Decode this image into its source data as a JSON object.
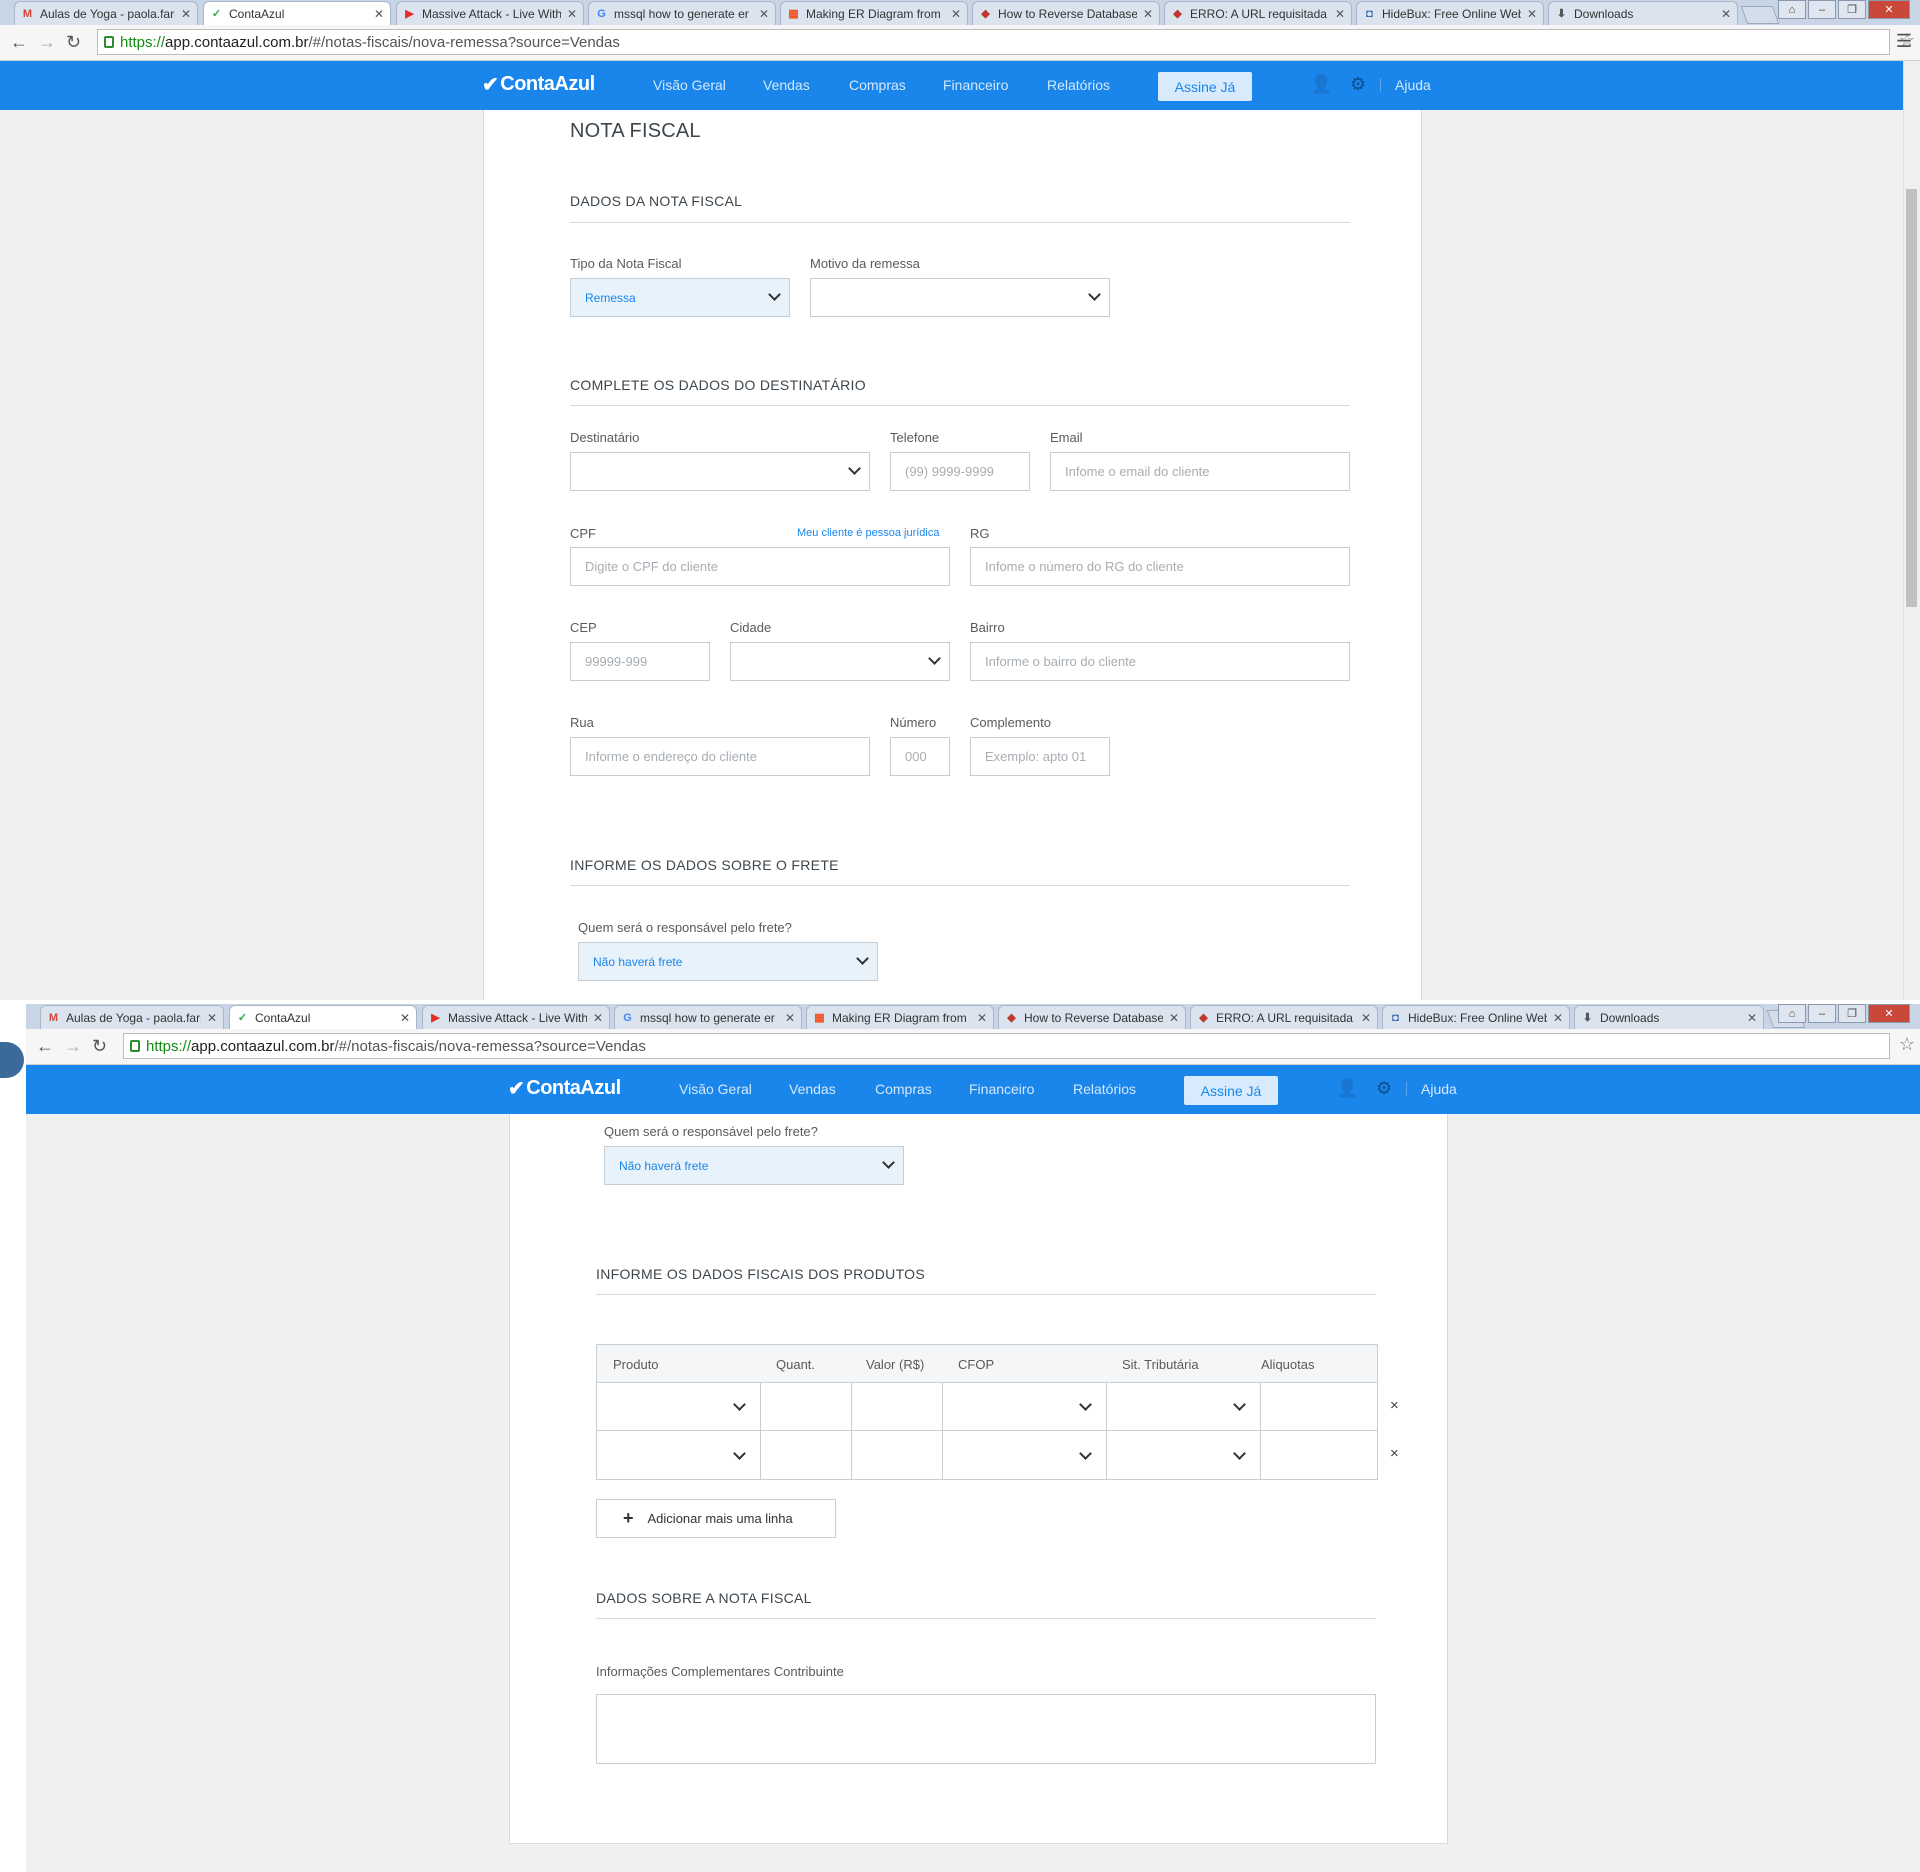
{
  "browser": {
    "tabs": [
      {
        "icon": "M",
        "label": "Aulas de Yoga - paola.fari"
      },
      {
        "icon": "✓",
        "label": "ContaAzul",
        "active": true
      },
      {
        "icon": "▶",
        "label": "Massive Attack - Live With"
      },
      {
        "icon": "G",
        "label": "mssql how to generate er"
      },
      {
        "icon": "▦",
        "label": "Making ER Diagram from"
      },
      {
        "icon": "◆",
        "label": "How to Reverse Database"
      },
      {
        "icon": "◆",
        "label": "ERRO: A URL requisitada"
      },
      {
        "icon": "◘",
        "label": "HideBux: Free Online Web"
      },
      {
        "icon": "⬇",
        "label": "Downloads"
      }
    ],
    "url_proto": "https://",
    "url_host": "app.contaazul.com.br",
    "url_path": "/#/notas-fiscais/nova-remessa?source=Vendas"
  },
  "nav": {
    "logo": "ContaAzul",
    "links": [
      "Visão Geral",
      "Vendas",
      "Compras",
      "Financeiro",
      "Relatórios"
    ],
    "cta": "Assine Já",
    "help": "Ajuda"
  },
  "form": {
    "title": "NOTA FISCAL",
    "section1": "DADOS DA NOTA FISCAL",
    "tipo_label": "Tipo da Nota Fiscal",
    "tipo_value": "Remessa",
    "motivo_label": "Motivo da remessa",
    "motivo_value": "",
    "section2": "COMPLETE OS DADOS DO DESTINATÁRIO",
    "destinatario_label": "Destinatário",
    "telefone_label": "Telefone",
    "telefone_placeholder": "(99) 9999-9999",
    "email_label": "Email",
    "email_placeholder": "Infome o email do cliente",
    "cpf_label": "CPF",
    "pj_link": "Meu cliente é pessoa jurídica",
    "cpf_placeholder": "Digite o CPF do cliente",
    "rg_label": "RG",
    "rg_placeholder": "Infome o número do RG do cliente",
    "cep_label": "CEP",
    "cep_placeholder": "99999-999",
    "cidade_label": "Cidade",
    "bairro_label": "Bairro",
    "bairro_placeholder": "Informe o bairro do cliente",
    "rua_label": "Rua",
    "rua_placeholder": "Informe o endereço do cliente",
    "numero_label": "Número",
    "numero_placeholder": "000",
    "complemento_label": "Complemento",
    "complemento_placeholder": "Exemplo: apto 01",
    "section3": "INFORME OS DADOS SOBRE O FRETE",
    "frete_label": "Quem será o responsável pelo frete?",
    "frete_value": "Não haverá frete",
    "section4": "INFORME OS DADOS FISCAIS DOS PRODUTOS",
    "table_headers": [
      "Produto",
      "Quant.",
      "Valor (R$)",
      "CFOP",
      "Sit. Tributária",
      "Aliquotas"
    ],
    "remove_icon": "×",
    "add_line": "Adicionar mais uma linha",
    "section5": "DADOS SOBRE A NOTA FISCAL",
    "info_label": "Informações Complementares Contribuinte"
  }
}
